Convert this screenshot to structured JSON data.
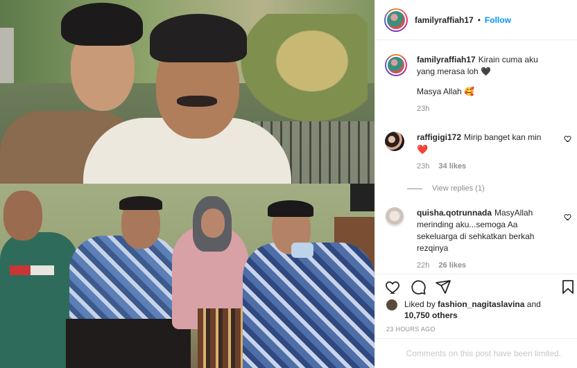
{
  "post": {
    "author": "familyraffiah17",
    "dot": "•",
    "follow_label": "Follow"
  },
  "comments": [
    {
      "user": "familyraffiah17",
      "text": "Kirain cuma aku yang merasa loh 🖤",
      "text2": "Masya Allah 🥰",
      "time": "23h"
    },
    {
      "user": "raffigigi172",
      "text": "Mirip banget kan min",
      "emoji": "❤️",
      "time": "23h",
      "likes": "34 likes",
      "view_replies": "View replies (1)"
    },
    {
      "user": "quisha.qotrunnada",
      "text": "MasyAllah merinding aku...semoga Aa sekeluarga di sehkatkan berkah rezqinya",
      "time": "22h",
      "likes": "26 likes"
    }
  ],
  "icons": {
    "like": "heart-icon",
    "comment": "comment-icon",
    "share": "paper-plane-icon",
    "save": "bookmark-icon"
  },
  "likes": {
    "prefix": "Liked by",
    "user": "fashion_nagitaslavina",
    "and": "and",
    "others": "10,750 others"
  },
  "timestamp": "23 HOURS AGO",
  "comments_limited": "Comments on this post have been limited.",
  "colors": {
    "follow": "#0095f6",
    "heart": "#ed4956",
    "muted": "#8e8e8e"
  }
}
